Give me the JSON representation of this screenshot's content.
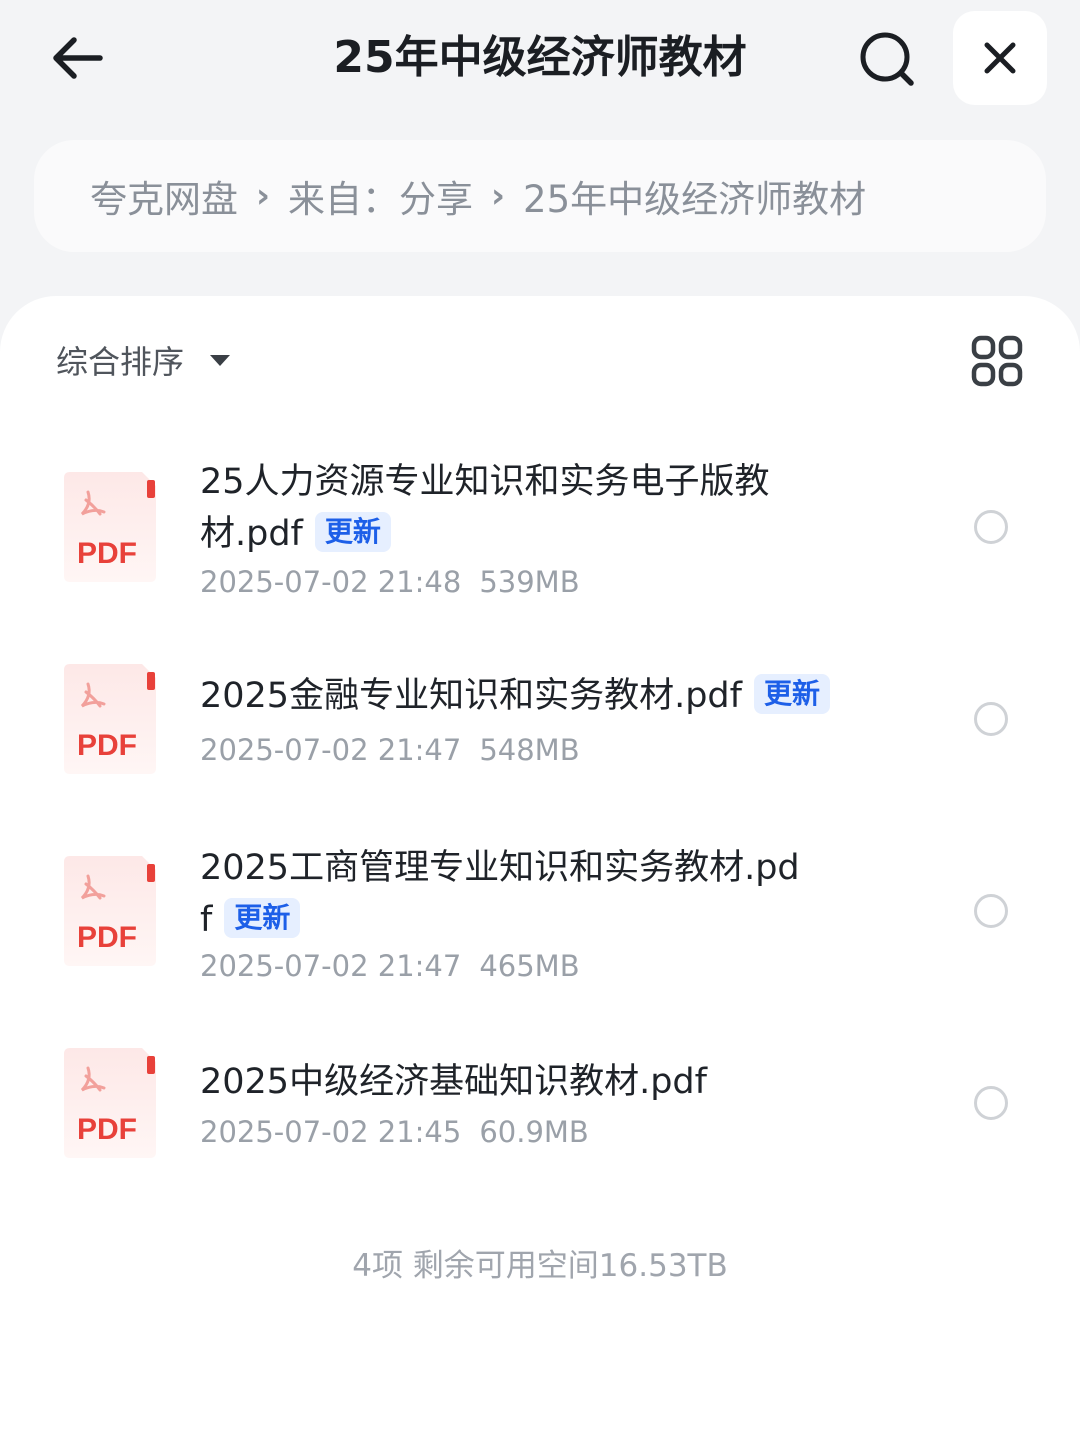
{
  "header": {
    "title": "25年中级经济师教材",
    "back_icon": "arrow-left-icon",
    "search_icon": "search-icon",
    "close_icon": "close-icon"
  },
  "breadcrumb": {
    "items": [
      "夸克网盘",
      "来自：分享",
      "25年中级经济师教材"
    ],
    "separator": "›"
  },
  "toolbar": {
    "sort_label": "综合排序",
    "view_icon": "grid-view-icon"
  },
  "files": [
    {
      "name": "25人力资源专业知识和实务电子版教材.pdf",
      "badge": "更新",
      "date": "2025-07-02 21:48",
      "size": "539MB",
      "icon_label": "PDF"
    },
    {
      "name": "2025金融专业知识和实务教材.pdf",
      "badge": "更新",
      "date": "2025-07-02 21:47",
      "size": "548MB",
      "icon_label": "PDF"
    },
    {
      "name": "2025工商管理专业知识和实务教材.pdf",
      "badge": "更新",
      "date": "2025-07-02 21:47",
      "size": "465MB",
      "icon_label": "PDF"
    },
    {
      "name": "2025中级经济基础知识教材.pdf",
      "badge": "",
      "date": "2025-07-02 21:45",
      "size": "60.9MB",
      "icon_label": "PDF"
    }
  ],
  "footer": {
    "summary": "4项 剩余可用空间16.53TB"
  },
  "colors": {
    "accent": "#1d5fe8",
    "pdf_red": "#e8413a",
    "background": "#f3f4f6"
  }
}
